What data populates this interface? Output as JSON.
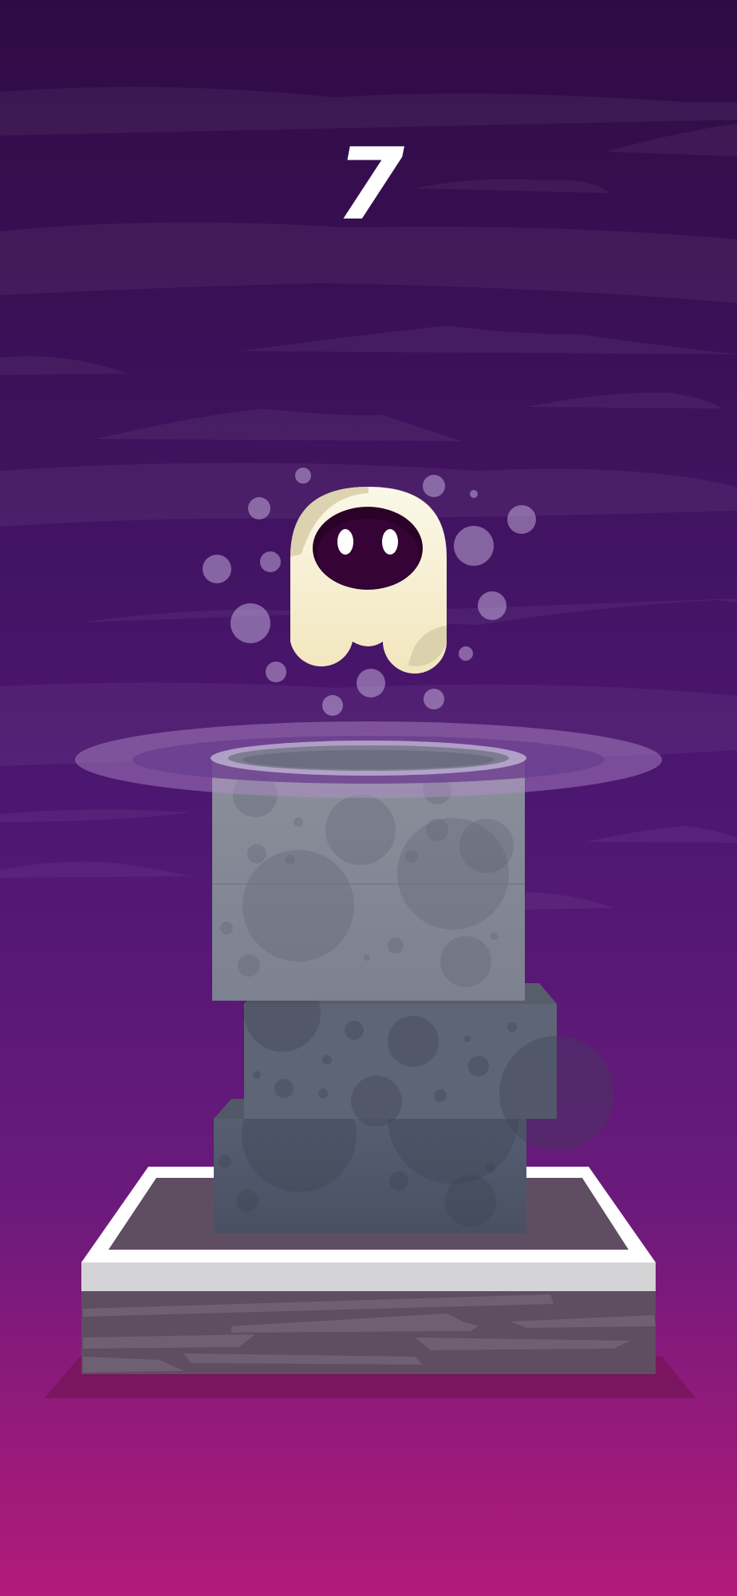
{
  "game": {
    "score": "7",
    "stacked_blocks": 3
  },
  "colors": {
    "sky_top": "#2f0b44",
    "sky_mid": "#4d1772",
    "sky_bottom": "#b21a79",
    "block_stone": "#5e6577",
    "block_active": "#9a9ea8",
    "base_frame": "#ffffff",
    "ghost_body": "#f8f1d4",
    "ghost_face": "#2a0228"
  },
  "icons": {
    "character": "ghost-icon",
    "landing_ring": "ripple-ring",
    "particles": "bubble-particles"
  }
}
